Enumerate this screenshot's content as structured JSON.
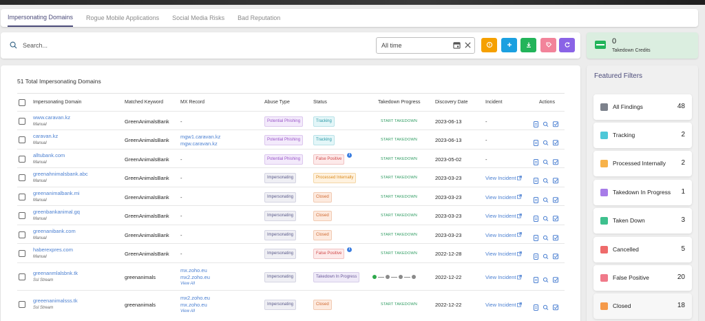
{
  "tabs": [
    {
      "label": "Impersonating Domains",
      "active": true
    },
    {
      "label": "Rogue Mobile Applications",
      "active": false
    },
    {
      "label": "Social Media Risks",
      "active": false
    },
    {
      "label": "Bad Reputation",
      "active": false
    }
  ],
  "search": {
    "placeholder": "Search...",
    "value": ""
  },
  "date_filter": {
    "value": "All time"
  },
  "toolbar_buttons": [
    {
      "name": "alert-button",
      "icon": "alert-circle-icon",
      "color": "#f5a000"
    },
    {
      "name": "add-button",
      "icon": "plus-icon",
      "color": "#1ba0e0"
    },
    {
      "name": "download-button",
      "icon": "download-icon",
      "color": "#22b45a"
    },
    {
      "name": "tag-button",
      "icon": "tag-icon",
      "color": "#f2839a"
    },
    {
      "name": "refresh-button",
      "icon": "refresh-icon",
      "color": "#8a63e6"
    }
  ],
  "credits": {
    "value": "0",
    "label": "Takedown Credits"
  },
  "table": {
    "total_label": "51 Total Impersonating Domains",
    "columns": [
      "Impersonating Domain",
      "Matched Keyword",
      "MX Record",
      "Abuse Type",
      "Status",
      "Takedown Progress",
      "Discovery Date",
      "Incident",
      "Actions"
    ],
    "rows": [
      {
        "domain": "www.caravan.kz",
        "source": "Manual",
        "keyword": "GreenAnimalsBank",
        "mx": [
          "-"
        ],
        "mx_more": "",
        "abuse": "Potential Phishing",
        "abuse_cls": "b-phish",
        "status": "Tracking",
        "status_cls": "b-tracking",
        "status_info": false,
        "progress": "START TAKEDOWN",
        "progress_dots": false,
        "date": "2023-06-13",
        "incident": "-",
        "incident_link": false
      },
      {
        "domain": "caravan.kz",
        "source": "Manual",
        "keyword": "GreenAnimalsBank",
        "mx": [
          "mgw1.caravan.kz",
          "mgw.caravan.kz"
        ],
        "mx_more": "",
        "abuse": "Potential Phishing",
        "abuse_cls": "b-phish",
        "status": "Tracking",
        "status_cls": "b-tracking",
        "status_info": false,
        "progress": "START TAKEDOWN",
        "progress_dots": false,
        "date": "2023-06-13",
        "incident": "-",
        "incident_link": false
      },
      {
        "domain": "alltubank.com",
        "source": "Manual",
        "keyword": "GreenAnimalsBank",
        "mx": [
          "-"
        ],
        "mx_more": "",
        "abuse": "Potential Phishing",
        "abuse_cls": "b-phish",
        "status": "False Positive",
        "status_cls": "b-fp",
        "status_info": true,
        "progress": "START TAKEDOWN",
        "progress_dots": false,
        "date": "2023-05-02",
        "incident": "-",
        "incident_link": false
      },
      {
        "domain": "greenahnimalsbank.abc",
        "source": "Manual",
        "keyword": "GreenAnimalsBank",
        "mx": [
          "-"
        ],
        "mx_more": "",
        "abuse": "Impersonating",
        "abuse_cls": "b-imp",
        "status": "Processed Internally",
        "status_cls": "b-pi",
        "status_info": false,
        "progress": "START TAKEDOWN",
        "progress_dots": false,
        "date": "2023-03-23",
        "incident": "View Incident",
        "incident_link": true
      },
      {
        "domain": "greenanimalbank.mi",
        "source": "Manual",
        "keyword": "GreenAnimalsBank",
        "mx": [
          "-"
        ],
        "mx_more": "",
        "abuse": "Impersonating",
        "abuse_cls": "b-imp",
        "status": "Closed",
        "status_cls": "b-closed",
        "status_info": false,
        "progress": "START TAKEDOWN",
        "progress_dots": false,
        "date": "2023-03-23",
        "incident": "View Incident",
        "incident_link": true
      },
      {
        "domain": "greenbankanimal.gq",
        "source": "Manual",
        "keyword": "GreenAnimalsBank",
        "mx": [
          "-"
        ],
        "mx_more": "",
        "abuse": "Impersonating",
        "abuse_cls": "b-imp",
        "status": "Closed",
        "status_cls": "b-closed",
        "status_info": false,
        "progress": "START TAKEDOWN",
        "progress_dots": false,
        "date": "2023-03-23",
        "incident": "View Incident",
        "incident_link": true
      },
      {
        "domain": "greenanibank.com",
        "source": "Manual",
        "keyword": "GreenAnimalsBank",
        "mx": [
          "-"
        ],
        "mx_more": "",
        "abuse": "Impersonating",
        "abuse_cls": "b-imp",
        "status": "Closed",
        "status_cls": "b-closed",
        "status_info": false,
        "progress": "START TAKEDOWN",
        "progress_dots": false,
        "date": "2023-03-23",
        "incident": "View Incident",
        "incident_link": true
      },
      {
        "domain": "haberexpres.com",
        "source": "Manual",
        "keyword": "GreenAnimalsBank",
        "mx": [
          "-"
        ],
        "mx_more": "",
        "abuse": "Impersonating",
        "abuse_cls": "b-imp",
        "status": "False Positive",
        "status_cls": "b-fp",
        "status_info": true,
        "progress": "START TAKEDOWN",
        "progress_dots": false,
        "date": "2022-12-28",
        "incident": "View Incident",
        "incident_link": true
      },
      {
        "domain": "greenanmlalsbnk.tk",
        "source": "Ssl Stream",
        "keyword": "greenanimals",
        "mx": [
          "mx.zoho.eu",
          "mx2.zoho.eu"
        ],
        "mx_more": "View All",
        "abuse": "Impersonating",
        "abuse_cls": "b-imp",
        "status": "Takedown In Progress",
        "status_cls": "b-tip",
        "status_info": false,
        "progress": "",
        "progress_dots": true,
        "date": "2022-12-22",
        "incident": "View Incident",
        "incident_link": true
      },
      {
        "domain": "greeenanimalsss.tk",
        "source": "Ssl Stream",
        "keyword": "greenanimals",
        "mx": [
          "mx2.zoho.eu",
          "mx.zoho.eu"
        ],
        "mx_more": "View All",
        "abuse": "Impersonating",
        "abuse_cls": "b-imp",
        "status": "Closed",
        "status_cls": "b-closed",
        "status_info": false,
        "progress": "START TAKEDOWN",
        "progress_dots": false,
        "date": "2022-12-22",
        "incident": "View Incident",
        "incident_link": true
      }
    ]
  },
  "featured_filters": {
    "title": "Featured Filters",
    "items": [
      {
        "label": "All Findings",
        "count": "48",
        "color": "#7d828c"
      },
      {
        "label": "Tracking",
        "count": "2",
        "color": "#4ec8d8"
      },
      {
        "label": "Processed Internally",
        "count": "2",
        "color": "#f7b24a"
      },
      {
        "label": "Takedown In Progress",
        "count": "1",
        "color": "#a77ce8"
      },
      {
        "label": "Taken Down",
        "count": "3",
        "color": "#3ec08e"
      },
      {
        "label": "Cancelled",
        "count": "5",
        "color": "#ee6b6b"
      },
      {
        "label": "False Positive",
        "count": "20",
        "color": "#f07a8a"
      },
      {
        "label": "Closed",
        "count": "18",
        "color": "#f59a4a"
      }
    ]
  }
}
